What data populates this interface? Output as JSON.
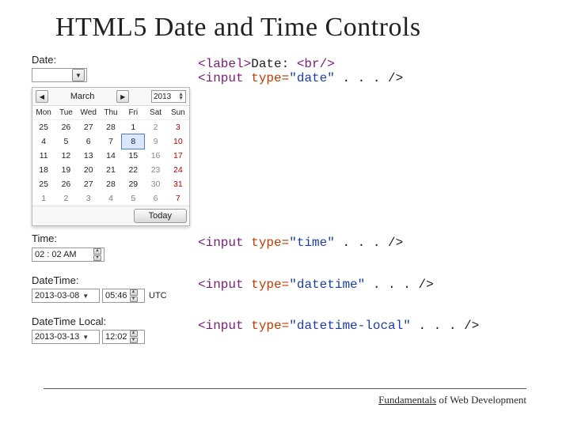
{
  "title": "HTML5 Date and Time Controls",
  "labels": {
    "date": "Date:",
    "time": "Time:",
    "datetime": "DateTime:",
    "datetimelocal": "DateTime Local:"
  },
  "code": {
    "line1a": "<label>",
    "line1b": "Date: ",
    "line1c": "<br/>",
    "line2a": "<input ",
    "line2b": "type=",
    "date_q": "\"date\"",
    "time_q": "\"time\"",
    "datetime_q": "\"datetime\"",
    "datetimelocal_q": "\"datetime-local\"",
    "tail": " . . . />"
  },
  "calendar": {
    "month": "March",
    "year": "2013",
    "dow": [
      "Mon",
      "Tue",
      "Wed",
      "Thu",
      "Fri",
      "Sat",
      "Sun"
    ],
    "today": "Today"
  },
  "time_value": "02 : 02   AM",
  "datetime": {
    "date": "2013-03-08",
    "time": "05:46",
    "utc": "UTC"
  },
  "datetimelocal": {
    "date": "2013-03-13",
    "time": "12:02"
  },
  "footer": {
    "u": "Fundamentals",
    "rest": " of Web Development"
  }
}
